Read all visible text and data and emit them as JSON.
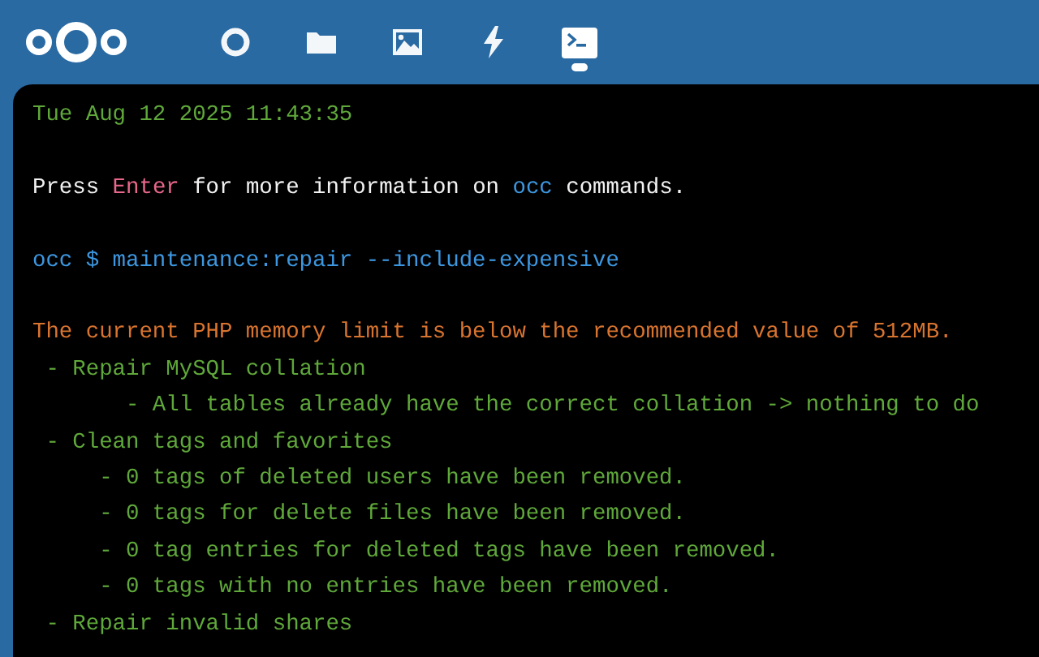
{
  "nav": [
    {
      "kind": "dashboard",
      "selected": false
    },
    {
      "kind": "files",
      "selected": false
    },
    {
      "kind": "photos",
      "selected": false
    },
    {
      "kind": "activity",
      "selected": false
    },
    {
      "kind": "terminal",
      "selected": true
    }
  ],
  "terminal": {
    "lines": [
      {
        "gap_before": false,
        "segments": [
          {
            "text": "Tue Aug 12 2025 11:43:35",
            "color": "#5fa83a"
          }
        ]
      },
      {
        "gap_before": true,
        "segments": [
          {
            "text": "Press ",
            "color": "#f2f2f2"
          },
          {
            "text": "Enter",
            "color": "#e8678a"
          },
          {
            "text": " for more information on ",
            "color": "#f2f2f2"
          },
          {
            "text": "occ",
            "color": "#3d97e0"
          },
          {
            "text": " commands.",
            "color": "#f2f2f2"
          }
        ]
      },
      {
        "gap_before": true,
        "segments": [
          {
            "text": "occ $ maintenance:repair --include-expensive",
            "color": "#3d97e0"
          }
        ]
      },
      {
        "gap_before": true,
        "segments": [
          {
            "text": "The current PHP memory limit is below the recommended value of 512MB.",
            "color": "#d9742f"
          }
        ]
      },
      {
        "gap_before": false,
        "segments": [
          {
            "text": " - Repair MySQL collation",
            "color": "#5fa83a"
          }
        ]
      },
      {
        "gap_before": false,
        "segments": [
          {
            "text": "       - All tables already have the correct collation -> nothing to do",
            "color": "#5fa83a"
          }
        ]
      },
      {
        "gap_before": false,
        "segments": [
          {
            "text": " - Clean tags and favorites",
            "color": "#5fa83a"
          }
        ]
      },
      {
        "gap_before": false,
        "segments": [
          {
            "text": "     - 0 tags of deleted users have been removed.",
            "color": "#5fa83a"
          }
        ]
      },
      {
        "gap_before": false,
        "segments": [
          {
            "text": "     - 0 tags for delete files have been removed.",
            "color": "#5fa83a"
          }
        ]
      },
      {
        "gap_before": false,
        "segments": [
          {
            "text": "     - 0 tag entries for deleted tags have been removed.",
            "color": "#5fa83a"
          }
        ]
      },
      {
        "gap_before": false,
        "segments": [
          {
            "text": "     - 0 tags with no entries have been removed.",
            "color": "#5fa83a"
          }
        ]
      },
      {
        "gap_before": false,
        "segments": [
          {
            "text": " - Repair invalid shares",
            "color": "#5fa83a"
          }
        ]
      }
    ]
  }
}
